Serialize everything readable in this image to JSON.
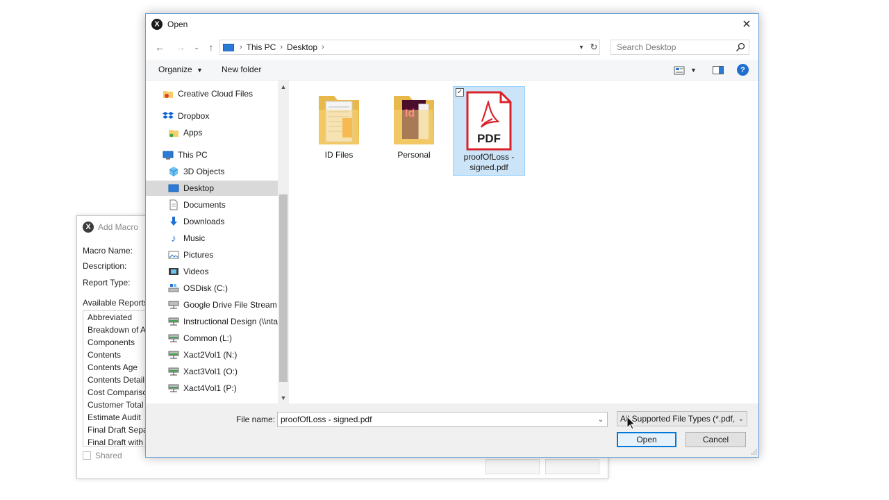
{
  "macro_window": {
    "title": "Add Macro",
    "macro_name_label": "Macro Name:",
    "description_label": "Description:",
    "report_type_label": "Report Type:",
    "available_reports_label": "Available Reports",
    "reports": [
      "Abbreviated",
      "Breakdown of A",
      "Components",
      "Contents",
      "Contents Age",
      "Contents Detail",
      "Cost Comparisc",
      "Customer Total",
      "Estimate Audit",
      "Final Draft Sepa",
      "Final Draft with"
    ],
    "shared_label": "Shared"
  },
  "dialog": {
    "title": "Open",
    "address": {
      "crumbs": [
        "This PC",
        "Desktop"
      ]
    },
    "search_placeholder": "Search Desktop",
    "toolbar": {
      "organize": "Organize",
      "new_folder": "New folder"
    },
    "nav_items": [
      {
        "label": "Creative Cloud Files",
        "icon": "creative-cloud-icon"
      },
      {
        "label": "Dropbox",
        "icon": "dropbox-icon"
      },
      {
        "label": "Apps",
        "icon": "folder-icon"
      },
      {
        "label": "This PC",
        "icon": "computer-icon"
      },
      {
        "label": "3D Objects",
        "icon": "cube-icon"
      },
      {
        "label": "Desktop",
        "icon": "desktop-icon",
        "selected": true
      },
      {
        "label": "Documents",
        "icon": "document-icon"
      },
      {
        "label": "Downloads",
        "icon": "download-icon"
      },
      {
        "label": "Music",
        "icon": "music-icon"
      },
      {
        "label": "Pictures",
        "icon": "pictures-icon"
      },
      {
        "label": "Videos",
        "icon": "video-icon"
      },
      {
        "label": "OSDisk (C:)",
        "icon": "disk-icon"
      },
      {
        "label": "Google Drive File Stream (",
        "icon": "network-drive-icon"
      },
      {
        "label": "Instructional Design (\\\\nta",
        "icon": "network-drive-icon"
      },
      {
        "label": "Common (L:)",
        "icon": "network-drive-icon"
      },
      {
        "label": "Xact2Vol1 (N:)",
        "icon": "network-drive-icon"
      },
      {
        "label": "Xact3Vol1 (O:)",
        "icon": "network-drive-icon"
      },
      {
        "label": "Xact4Vol1 (P:)",
        "icon": "network-drive-icon"
      }
    ],
    "files": [
      {
        "name": "ID Files",
        "type": "folder"
      },
      {
        "name": "Personal",
        "type": "folder"
      },
      {
        "name": "proofOfLoss - signed.pdf",
        "name_line1": "proofOfLoss -",
        "name_line2": "signed.pdf",
        "type": "pdf",
        "badge": "PDF",
        "selected": true
      }
    ],
    "file_name_label": "File name:",
    "file_name_value": "proofOfLoss - signed.pdf",
    "file_type_value": "All Supported File Types (*.pdf,",
    "open_label": "Open",
    "cancel_label": "Cancel"
  },
  "colors": {
    "accent": "#0078d7",
    "selection": "#cce4f7",
    "folder": "#f5cf6b",
    "pdf_red": "#d9232a"
  }
}
